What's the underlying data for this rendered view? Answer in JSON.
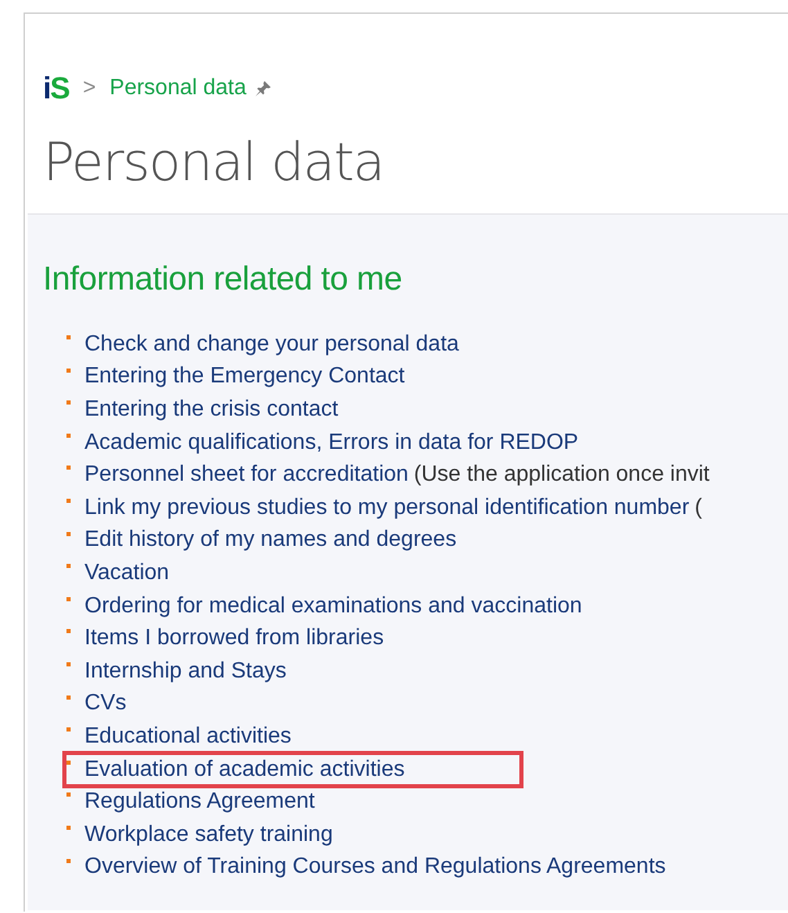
{
  "breadcrumb": {
    "logo": "iS",
    "separator": ">",
    "current": "Personal data",
    "pinned": true
  },
  "page_title": "Personal data",
  "section": {
    "heading": "Information related to me",
    "items": [
      {
        "label": "Check and change your personal data",
        "highlighted": false
      },
      {
        "label": "Entering the Emergency Contact",
        "highlighted": false
      },
      {
        "label": "Entering the crisis contact",
        "highlighted": false
      },
      {
        "label": "Academic qualifications, Errors in data for REDOP",
        "highlighted": false
      },
      {
        "label": "Personnel sheet for accreditation",
        "note": "(Use the application once invit",
        "highlighted": false
      },
      {
        "label": "Link my previous studies to my personal identification number",
        "note": "(",
        "highlighted": false
      },
      {
        "label": "Edit history of my names and degrees",
        "highlighted": false
      },
      {
        "label": "Vacation",
        "highlighted": false
      },
      {
        "label": "Ordering for medical examinations and vaccination",
        "highlighted": false
      },
      {
        "label": "Items I borrowed from libraries",
        "highlighted": false
      },
      {
        "label": "Internship and Stays",
        "highlighted": false
      },
      {
        "label": "CVs",
        "highlighted": false
      },
      {
        "label": "Educational activities",
        "highlighted": false
      },
      {
        "label": "Evaluation of academic activities",
        "highlighted": true
      },
      {
        "label": "Regulations Agreement",
        "highlighted": false
      },
      {
        "label": "Workplace safety training",
        "highlighted": false
      },
      {
        "label": "Overview of Training Courses and Regulations Agreements",
        "highlighted": false
      }
    ]
  }
}
